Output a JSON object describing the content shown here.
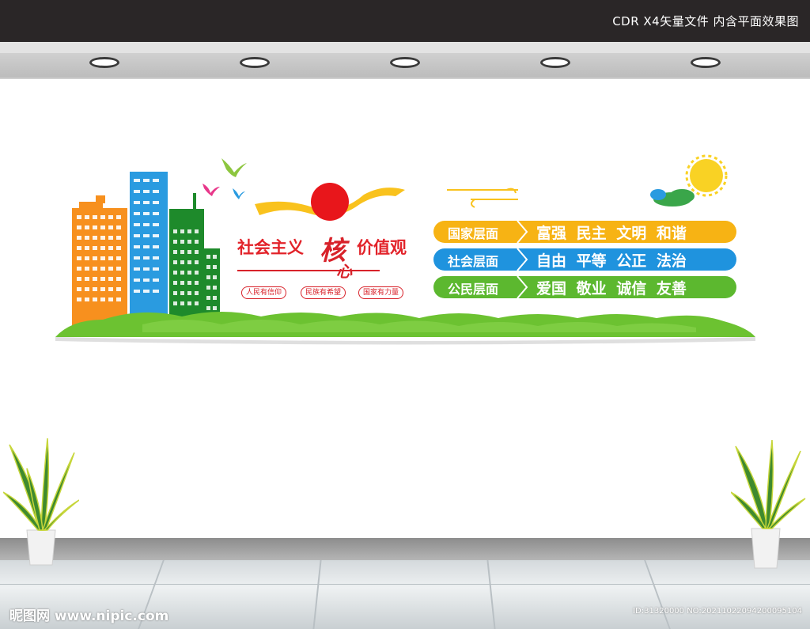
{
  "header": {
    "caption": "CDR X4矢量文件  内含平面效果图"
  },
  "panel": {
    "title_left": "社会主义",
    "title_he": "核",
    "title_xin": "心",
    "title_right": "价值观",
    "tags": [
      "人民有信仰",
      "民族有希望",
      "国家有力量"
    ],
    "rows": [
      {
        "category": "国家层面",
        "values": "富强 民主 文明 和谐",
        "color": "#f7b314"
      },
      {
        "category": "社会层面",
        "values": "自由 平等 公正 法治",
        "color": "#1f93de"
      },
      {
        "category": "公民层面",
        "values": "爱国 敬业 诚信 友善",
        "color": "#5cb82f"
      }
    ],
    "colors": {
      "orange": "#f7901e",
      "blue": "#2a9be0",
      "green": "#1e8a2b",
      "grass": "#6cc231",
      "red": "#e2232a",
      "yellow": "#f9c21d"
    }
  },
  "watermark": {
    "left": "昵图网 www.nipic.com",
    "right": "ID:31320000 NO:20211022094200095104"
  }
}
